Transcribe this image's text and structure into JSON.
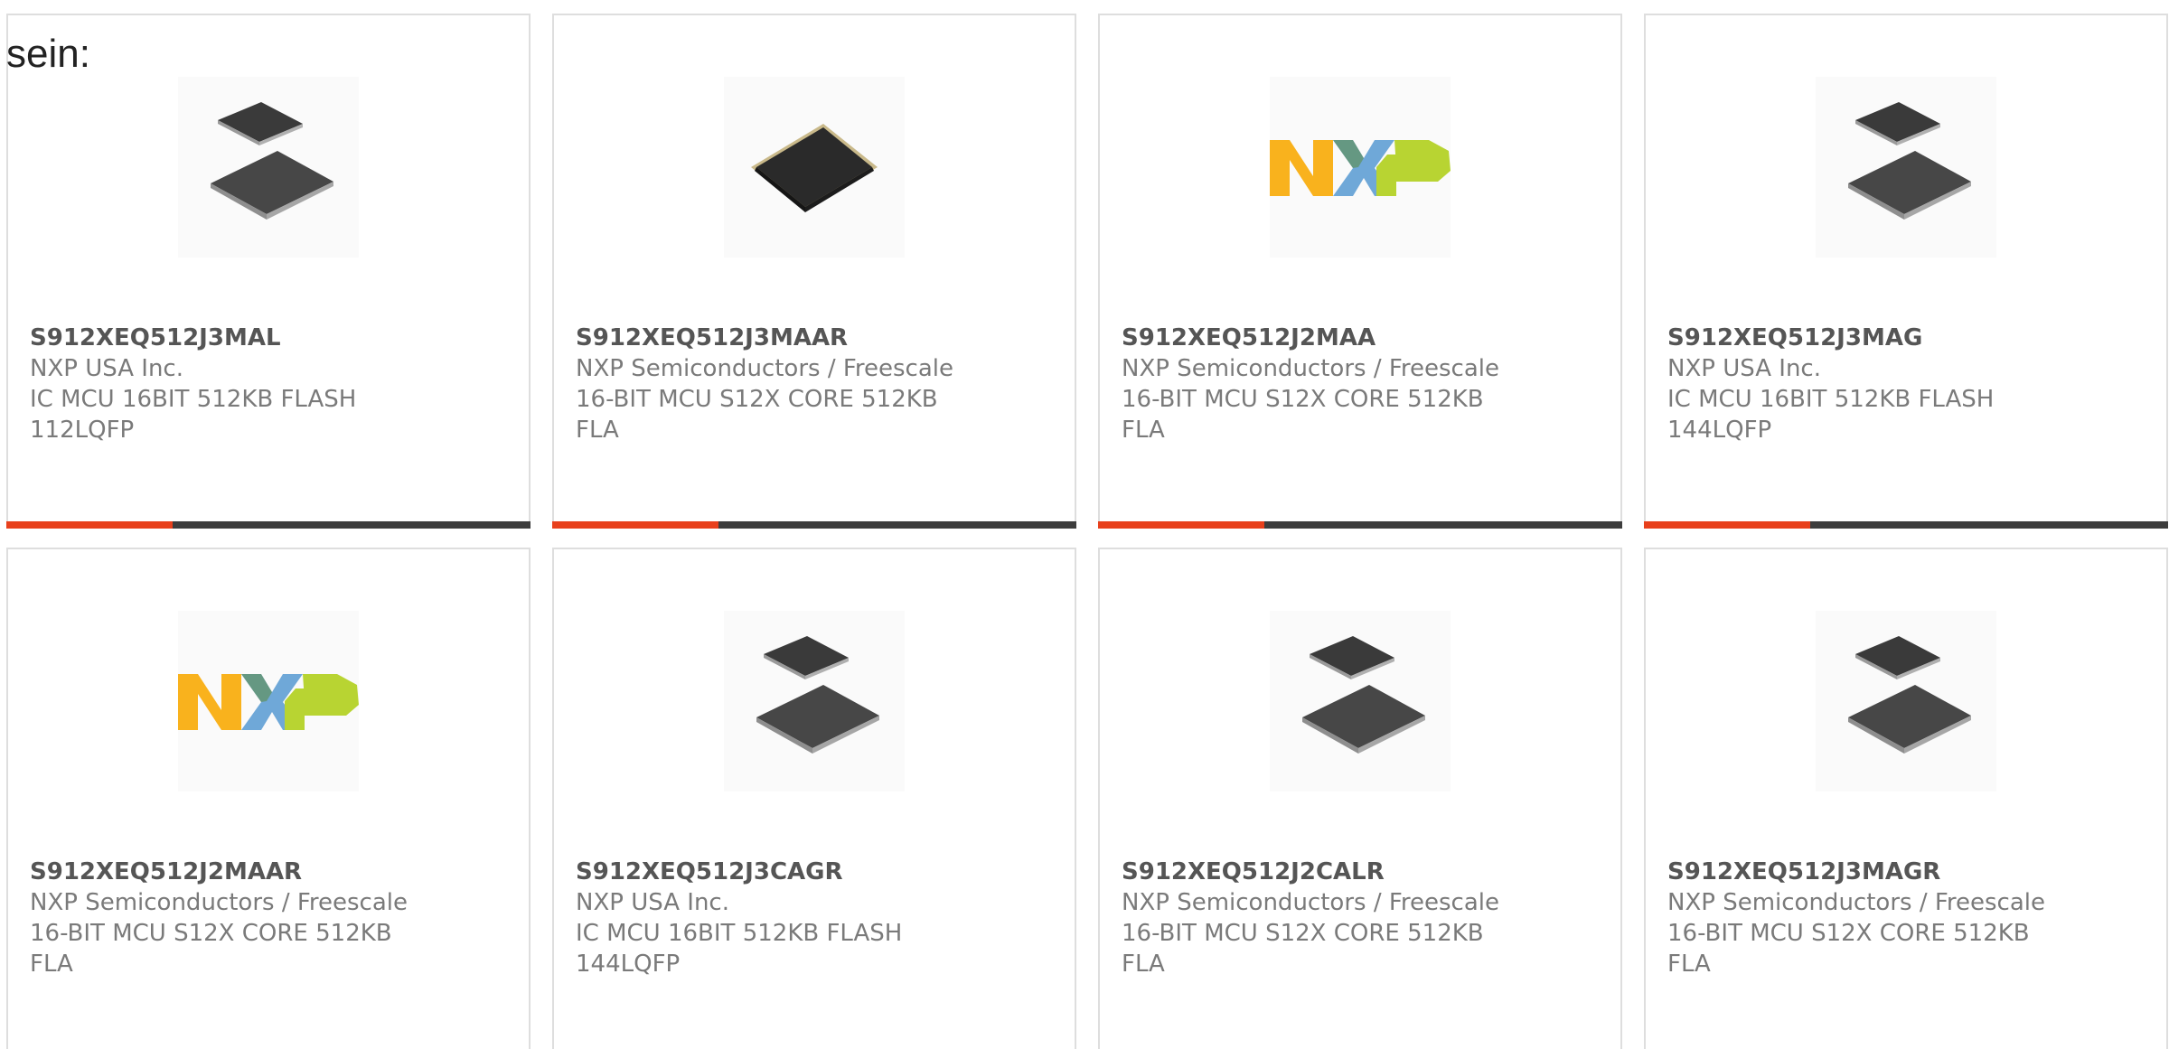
{
  "intro": "sein:",
  "colors": {
    "accent": "#e8401c",
    "bar": "#3d3d3d",
    "nxp_orange": "#f9b21d",
    "nxp_blue": "#6fa8d8",
    "nxp_green": "#b8d432"
  },
  "products": [
    {
      "part": "S912XEQ512J3MAL",
      "manufacturer": "NXP USA Inc.",
      "description": "IC MCU 16BIT 512KB FLASH 112LQFP",
      "image": "two-chips"
    },
    {
      "part": "S912XEQ512J3MAAR",
      "manufacturer": "NXP Semiconductors / Freescale",
      "description": "16-BIT MCU S12X CORE 512KB FLA",
      "image": "single-chip"
    },
    {
      "part": "S912XEQ512J2MAA",
      "manufacturer": "NXP Semiconductors / Freescale",
      "description": "16-BIT MCU S12X CORE 512KB FLA",
      "image": "nxp-logo"
    },
    {
      "part": "S912XEQ512J3MAG",
      "manufacturer": "NXP USA Inc.",
      "description": "IC MCU 16BIT 512KB FLASH 144LQFP",
      "image": "two-chips"
    },
    {
      "part": "S912XEQ512J2MAAR",
      "manufacturer": "NXP Semiconductors / Freescale",
      "description": "16-BIT MCU S12X CORE 512KB FLA",
      "image": "nxp-logo"
    },
    {
      "part": "S912XEQ512J3CAGR",
      "manufacturer": "NXP USA Inc.",
      "description": "IC MCU 16BIT 512KB FLASH 144LQFP",
      "image": "two-chips"
    },
    {
      "part": "S912XEQ512J2CALR",
      "manufacturer": "NXP Semiconductors / Freescale",
      "description": "16-BIT MCU S12X CORE 512KB FLA",
      "image": "two-chips"
    },
    {
      "part": "S912XEQ512J3MAGR",
      "manufacturer": "NXP Semiconductors / Freescale",
      "description": "16-BIT MCU S12X CORE 512KB FLA",
      "image": "two-chips"
    }
  ]
}
